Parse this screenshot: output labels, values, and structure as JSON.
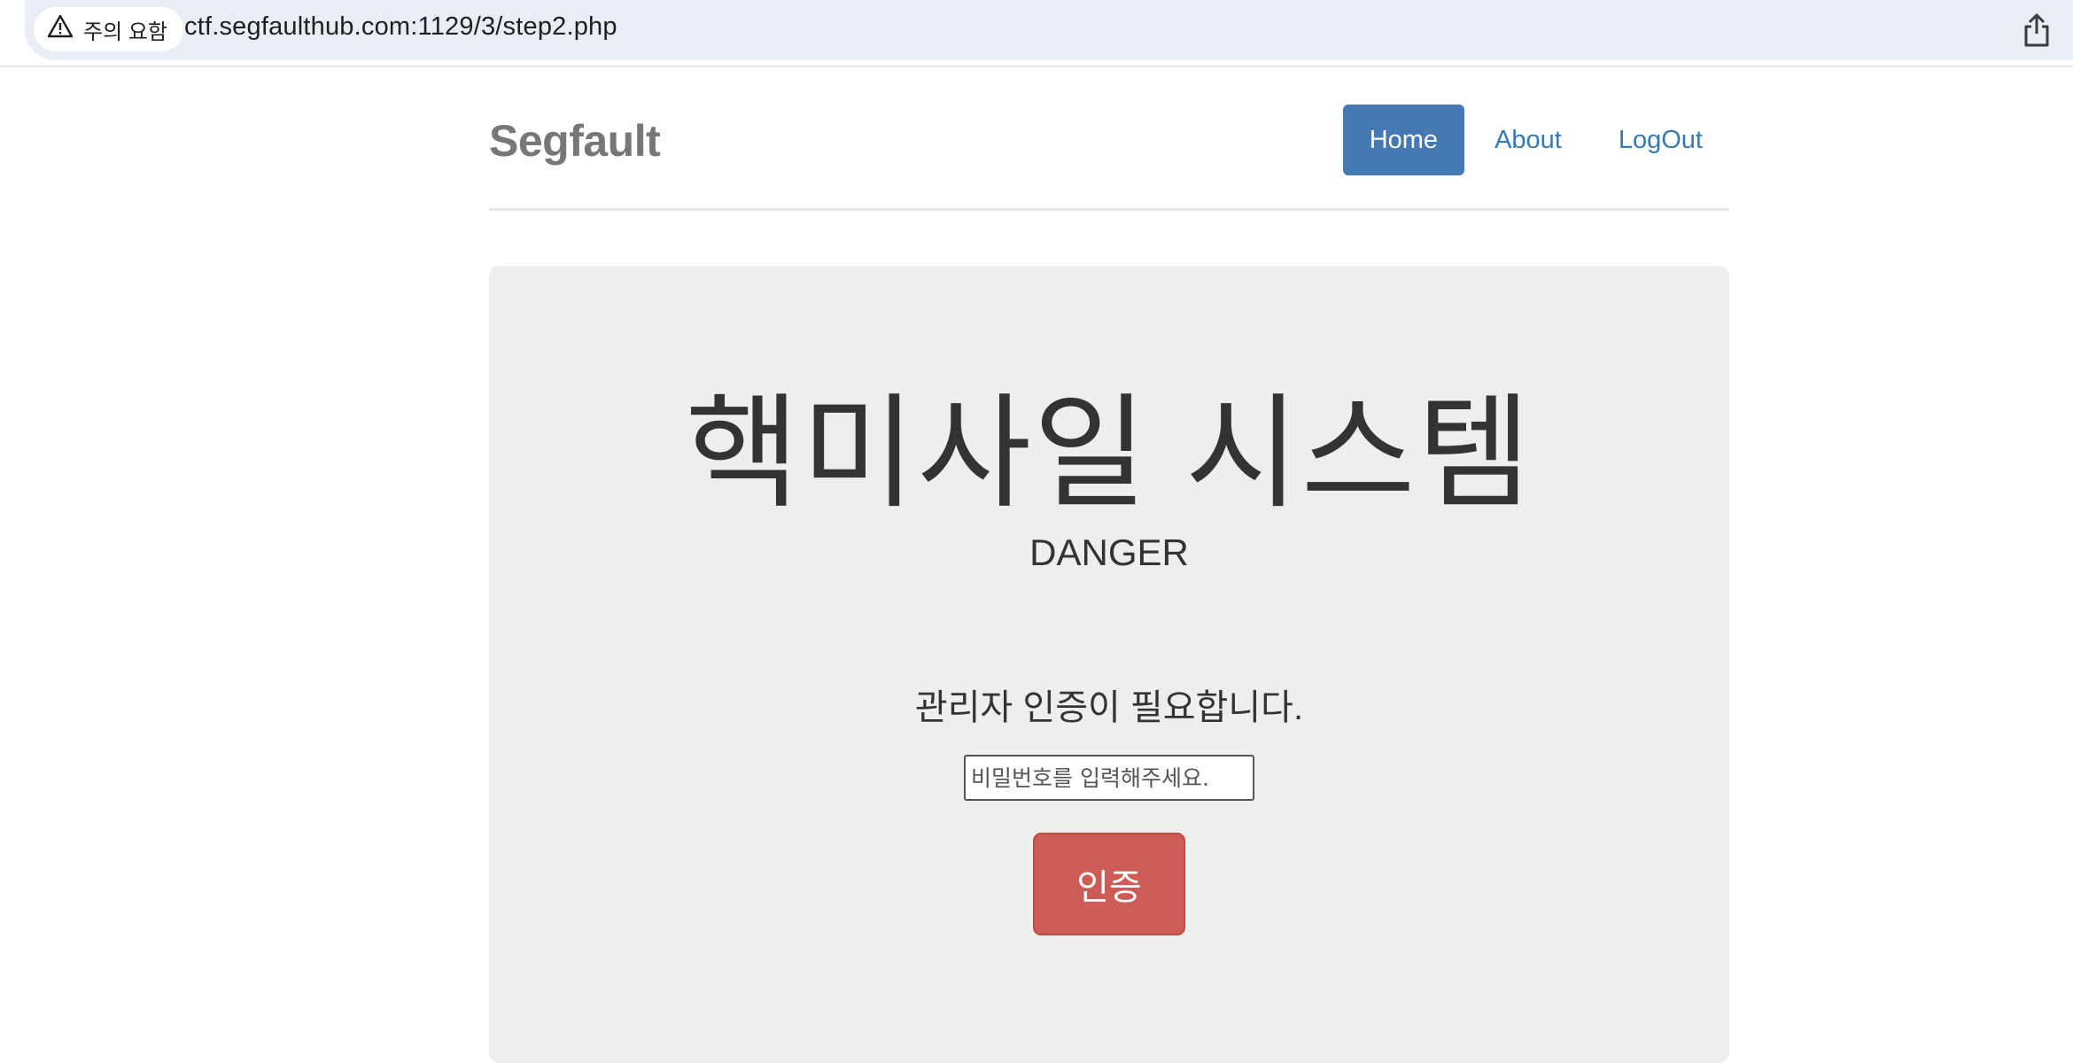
{
  "browser": {
    "security_label": "주의 요함",
    "url": "ctf.segfaulthub.com:1129/3/step2.php"
  },
  "navbar": {
    "brand": "Segfault",
    "items": [
      {
        "label": "Home",
        "active": true
      },
      {
        "label": "About",
        "active": false
      },
      {
        "label": "LogOut",
        "active": false
      }
    ]
  },
  "jumbotron": {
    "title": "핵미사일 시스템",
    "subtitle": "DANGER",
    "prompt": "관리자 인증이 필요합니다.",
    "password_placeholder": "비밀번호를 입력해주세요.",
    "password_value": "",
    "submit_label": "인증"
  },
  "colors": {
    "nav_active_bg": "#4479b5",
    "nav_link": "#337ab7",
    "button_danger": "#cc5c55",
    "jumbotron_bg": "#eeeeee"
  }
}
